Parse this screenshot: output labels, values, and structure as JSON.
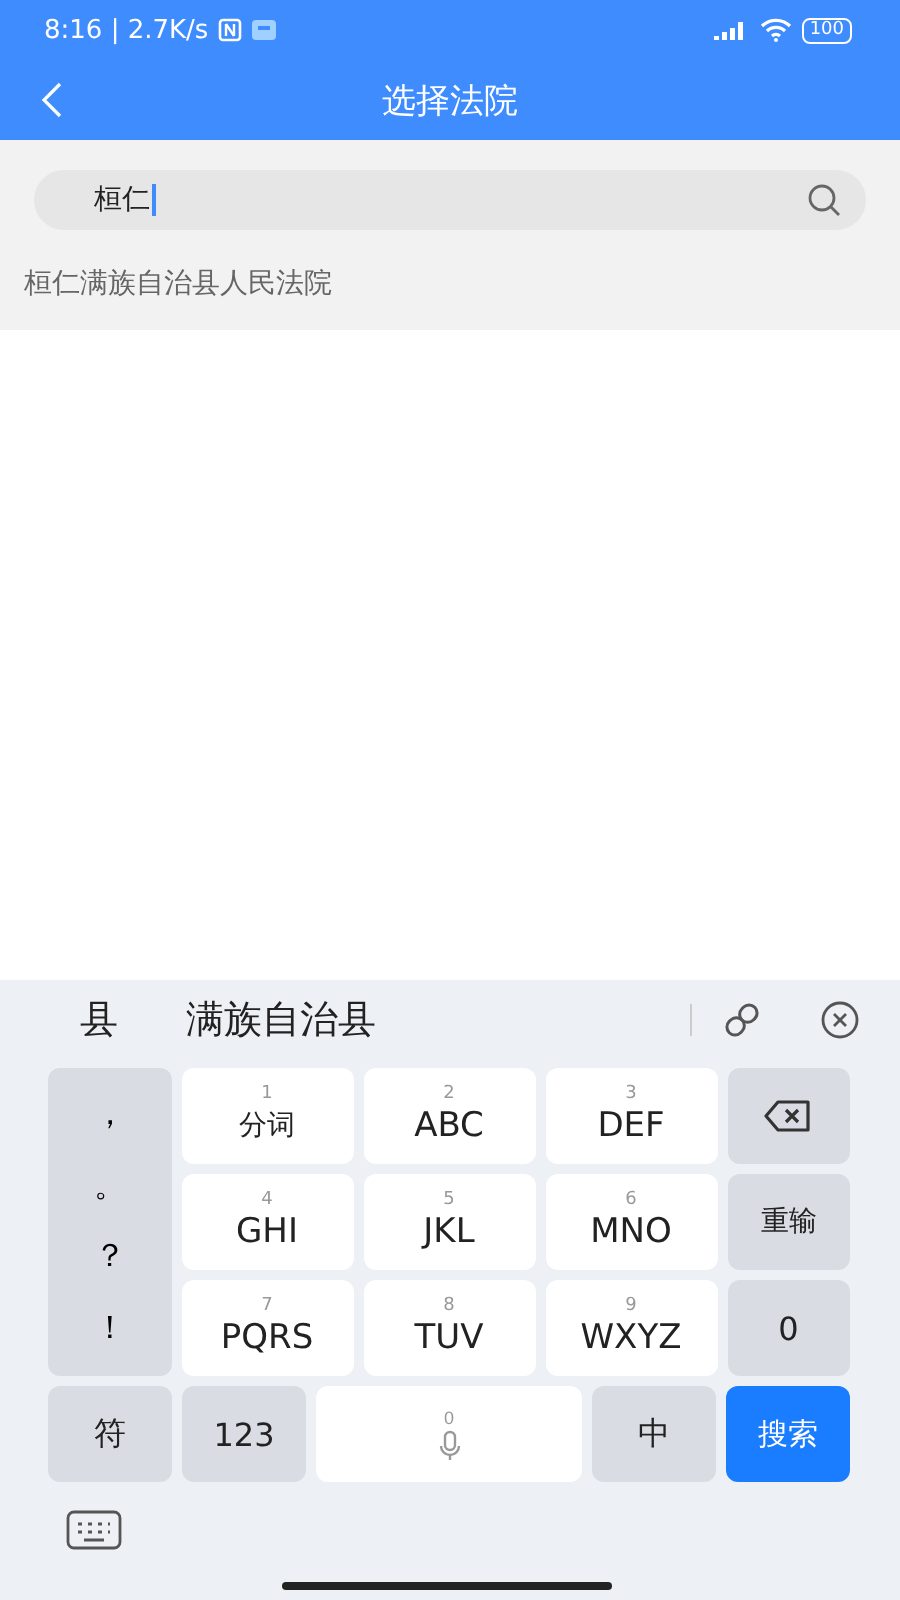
{
  "status_bar": {
    "time_and_speed": "8:16 | 2.7K/s",
    "battery": "100"
  },
  "header": {
    "title": "选择法院"
  },
  "search": {
    "value": "桓仁"
  },
  "results": [
    "桓仁满族自治县人民法院"
  ],
  "keyboard": {
    "candidates": [
      "县",
      "满族自治县"
    ],
    "punctuation": [
      "，",
      "。",
      "？",
      "！"
    ],
    "keys": [
      {
        "num": "1",
        "label": "分词"
      },
      {
        "num": "2",
        "label": "ABC"
      },
      {
        "num": "3",
        "label": "DEF"
      },
      {
        "num": "4",
        "label": "GHI"
      },
      {
        "num": "5",
        "label": "JKL"
      },
      {
        "num": "6",
        "label": "MNO"
      },
      {
        "num": "7",
        "label": "PQRS"
      },
      {
        "num": "8",
        "label": "TUV"
      },
      {
        "num": "9",
        "label": "WXYZ"
      }
    ],
    "side_keys": [
      {
        "kind": "backspace"
      },
      {
        "kind": "text",
        "label": "重输"
      },
      {
        "kind": "text",
        "label": "0"
      }
    ],
    "bottom_keys": [
      {
        "kind": "text",
        "label": "符"
      },
      {
        "kind": "text",
        "label": "123"
      },
      {
        "kind": "space",
        "label": "0"
      },
      {
        "kind": "text",
        "label": "中"
      },
      {
        "kind": "action",
        "label": "搜索"
      }
    ]
  }
}
